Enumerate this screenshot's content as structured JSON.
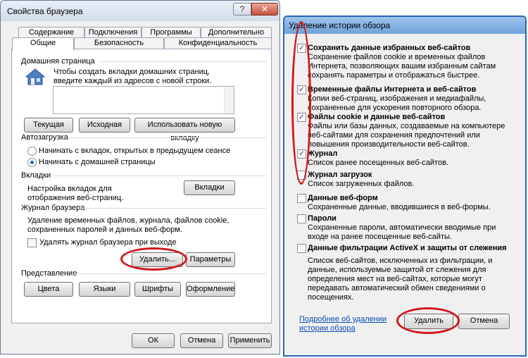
{
  "win1": {
    "title": "Свойства браузера",
    "help_glyph": "?",
    "close_glyph": "✕",
    "tabs": [
      "Содержание",
      "Подключения",
      "Программы",
      "Дополнительно",
      "Общие",
      "Безопасность",
      "Конфиденциальность"
    ],
    "home": {
      "group": "Домашняя страница",
      "hint": "Чтобы создать вкладки домашних страниц, введите каждый из адресов с новой строки.",
      "buttons": [
        "Текущая",
        "Исходная",
        "Использовать новую вкладку"
      ]
    },
    "startup": {
      "group": "Автозагрузка",
      "options": [
        "Начинать с вкладок, открытых в предыдущем сеансе",
        "Начинать с домашней страницы"
      ],
      "selected": 1
    },
    "tabs_group": {
      "group": "Вкладки",
      "text": "Настройка вкладок для отображения веб-страниц.",
      "button": "Вкладки"
    },
    "history": {
      "group": "Журнал браузера",
      "text": "Удаление временных файлов, журнала, файлов cookie, сохраненных паролей и данных веб-форм.",
      "checkbox": "Удалять журнал браузера при выходе",
      "delete_button": "Удалить...",
      "params_button": "Параметры"
    },
    "appearance": {
      "group": "Представление",
      "buttons": [
        "Цвета",
        "Языки",
        "Шрифты",
        "Оформление"
      ]
    },
    "footer": {
      "ok": "ОК",
      "cancel": "Отмена",
      "apply": "Применить"
    }
  },
  "win2": {
    "title": "Удаление истории обзора",
    "items": [
      {
        "label": "Сохранить данные избранных веб-сайтов",
        "desc": "Сохранение файлов cookie и временных файлов Интернета, позволяющих вашим избранным сайтам сохранять параметры и отображаться быстрее.",
        "checked": true
      },
      {
        "label": "Временные файлы Интернета и веб-сайтов",
        "desc": "Копии веб-страниц, изображения и медиафайлы, сохраненные для ускорения повторного обзора.",
        "checked": true
      },
      {
        "label": "Файлы cookie и данные веб-сайтов",
        "desc": "Файлы или базы данных, создаваемые на компьютере веб-сайтами для сохранения предпочтений или повышения производительности веб-сайтов.",
        "checked": true
      },
      {
        "label": "Журнал",
        "desc": "Список ранее посещенных веб-сайтов.",
        "checked": true
      },
      {
        "label": "Журнал загрузок",
        "desc": "Список загруженных файлов.",
        "checked": false
      },
      {
        "label": "Данные веб-форм",
        "desc": "Сохраненные данные, вводившиеся в веб-формы.",
        "checked": false
      },
      {
        "label": "Пароли",
        "desc": "Сохраненные пароли, автоматически вводимые при входе на ранее посещенные веб-сайты.",
        "checked": false
      },
      {
        "label": "Данные фильтрации ActiveX и защиты от слежения",
        "desc": "Список веб-сайтов, исключенных из фильтрации, и данные, используемые защитой от слежения для определения мест на веб-сайтах, которые могут передавать автоматический обмен сведениями о посещениях.",
        "checked": false
      }
    ],
    "link": "Подробнее об удалении истории обзора",
    "delete_button": "Удалить",
    "cancel_button": "Отмена"
  },
  "check_glyph": "✓",
  "colors": {
    "highlight": "#d0181c",
    "link": "#0a4bb3"
  }
}
